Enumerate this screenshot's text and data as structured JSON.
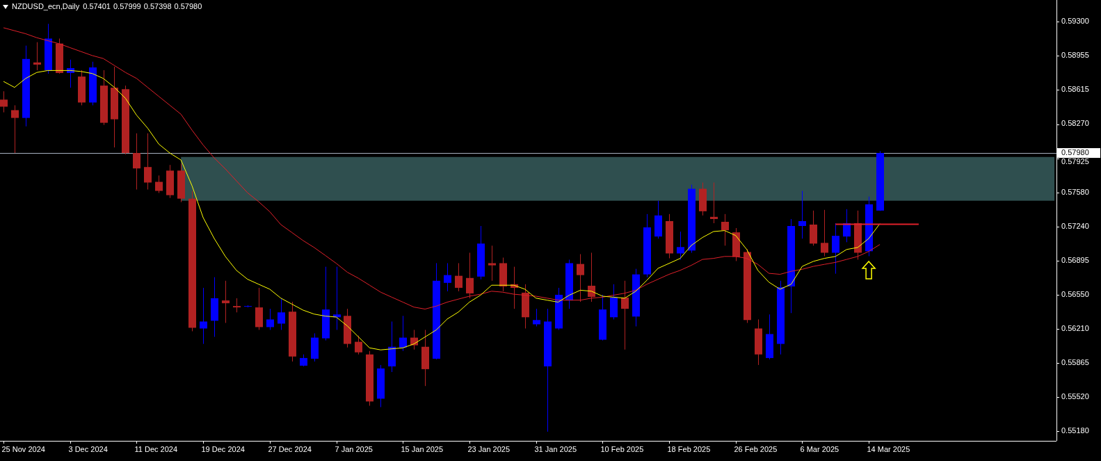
{
  "header": {
    "symbol": "NZDUSD_ecn,Daily",
    "ohlc": [
      "0.57401",
      "0.57999",
      "0.57398",
      "0.57980"
    ]
  },
  "price_axis": {
    "labels": [
      "0.59300",
      "0.58955",
      "0.58615",
      "0.58270",
      "0.57925",
      "0.57580",
      "0.57240",
      "0.56895",
      "0.56550",
      "0.56210",
      "0.55865",
      "0.55520",
      "0.55180"
    ],
    "current_price": "0.57980"
  },
  "time_axis": {
    "labels": [
      "25 Nov 2024",
      "3 Dec 2024",
      "11 Dec 2024",
      "19 Dec 2024",
      "27 Dec 2024",
      "7 Jan 2025",
      "15 Jan 2025",
      "23 Jan 2025",
      "31 Jan 2025",
      "10 Feb 2025",
      "18 Feb 2025",
      "26 Feb 2025",
      "6 Mar 2025",
      "14 Mar 2025"
    ]
  }
}
